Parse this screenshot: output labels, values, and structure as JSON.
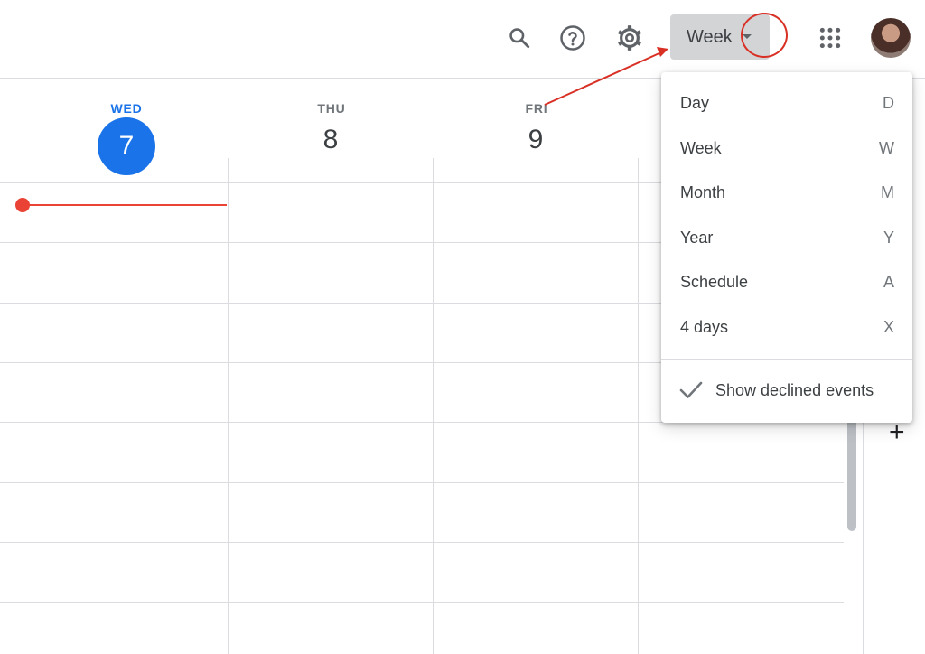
{
  "toolbar": {
    "search_icon": "search-icon",
    "help_icon": "help-icon",
    "settings_icon": "gear-icon",
    "view_button_label": "Week",
    "apps_icon": "apps-grid-icon",
    "avatar": "avatar"
  },
  "days": [
    {
      "name": "WED",
      "number": "7",
      "today": true
    },
    {
      "name": "THU",
      "number": "8",
      "today": false
    },
    {
      "name": "FRI",
      "number": "9",
      "today": false
    }
  ],
  "view_menu": {
    "items": [
      {
        "label": "Day",
        "shortcut": "D"
      },
      {
        "label": "Week",
        "shortcut": "W"
      },
      {
        "label": "Month",
        "shortcut": "M"
      },
      {
        "label": "Year",
        "shortcut": "Y"
      },
      {
        "label": "Schedule",
        "shortcut": "A"
      },
      {
        "label": "4 days",
        "shortcut": "X"
      }
    ],
    "show_declined_label": "Show declined events"
  },
  "side": {
    "add_label": "+"
  },
  "colors": {
    "accent": "#1a73e8",
    "now_indicator": "#ea4335",
    "annotation": "#d93025"
  }
}
